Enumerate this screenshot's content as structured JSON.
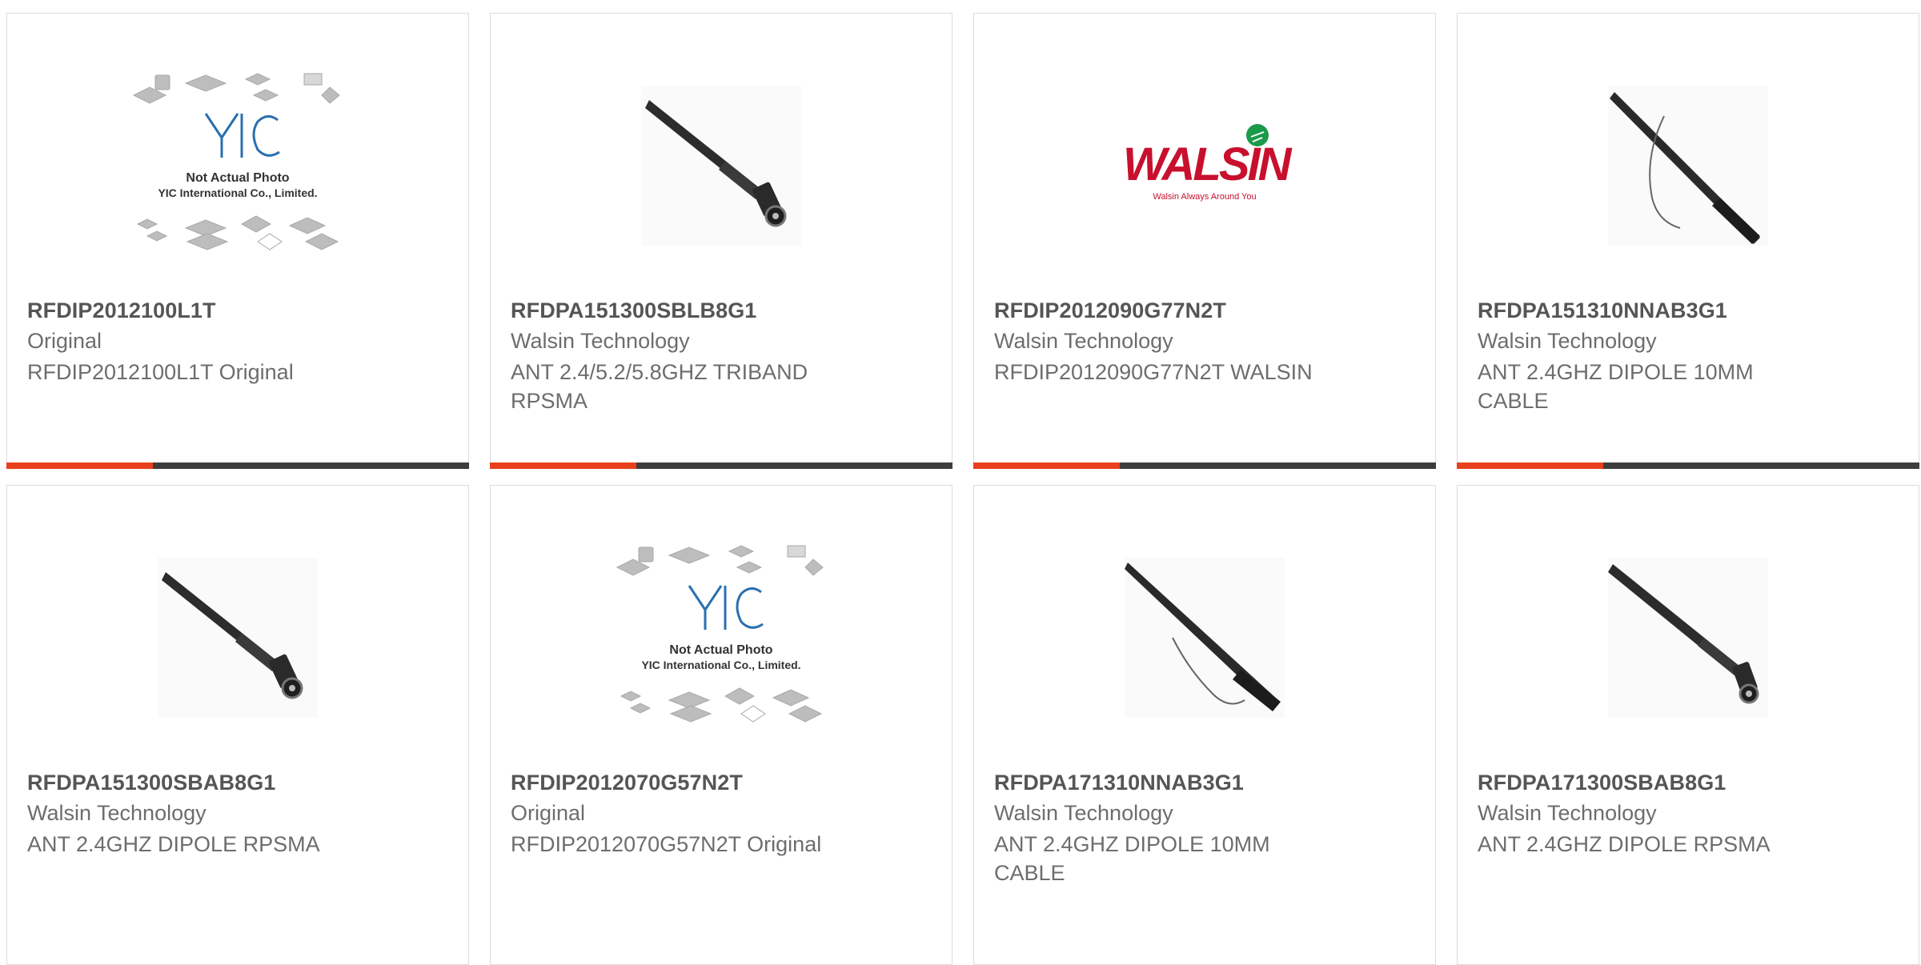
{
  "products": [
    {
      "part": "RFDIP2012100L1T",
      "manufacturer": "Original",
      "description": "RFDIP2012100L1T Original",
      "image": "yic-placeholder-icon",
      "placeholder_line1": "Not Actual Photo",
      "placeholder_line2": "YIC International Co., Limited.",
      "placeholder_logo": "YIC"
    },
    {
      "part": "RFDPA151300SBLB8G1",
      "manufacturer": "Walsin Technology",
      "description": "ANT 2.4/5.2/5.8GHZ TRIBAND RPSMA",
      "image": "antenna-icon"
    },
    {
      "part": "RFDIP2012090G77N2T",
      "manufacturer": "Walsin Technology",
      "description": "RFDIP2012090G77N2T WALSIN",
      "image": "walsin-logo-icon",
      "logo_text": "WALSIN",
      "logo_tagline": "Walsin Always Around You"
    },
    {
      "part": "RFDPA151310NNAB3G1",
      "manufacturer": "Walsin Technology",
      "description": "ANT 2.4GHZ DIPOLE 10MM CABLE",
      "image": "antenna-cable-icon"
    },
    {
      "part": "RFDPA151300SBAB8G1",
      "manufacturer": "Walsin Technology",
      "description": "ANT 2.4GHZ DIPOLE RPSMA",
      "image": "antenna-icon"
    },
    {
      "part": "RFDIP2012070G57N2T",
      "manufacturer": "Original",
      "description": "RFDIP2012070G57N2T Original",
      "image": "yic-placeholder-icon",
      "placeholder_line1": "Not Actual Photo",
      "placeholder_line2": "YIC International Co., Limited.",
      "placeholder_logo": "YIC"
    },
    {
      "part": "RFDPA171310NNAB3G1",
      "manufacturer": "Walsin Technology",
      "description": "ANT 2.4GHZ DIPOLE 10MM CABLE",
      "image": "antenna-cable-icon"
    },
    {
      "part": "RFDPA171300SBAB8G1",
      "manufacturer": "Walsin Technology",
      "description": "ANT 2.4GHZ DIPOLE RPSMA",
      "image": "antenna-icon"
    }
  ],
  "colors": {
    "accent": "#e8401c",
    "bar": "#3d3d3d",
    "border": "#dcdcdc",
    "text": "#6d6d6d",
    "title": "#555555"
  }
}
